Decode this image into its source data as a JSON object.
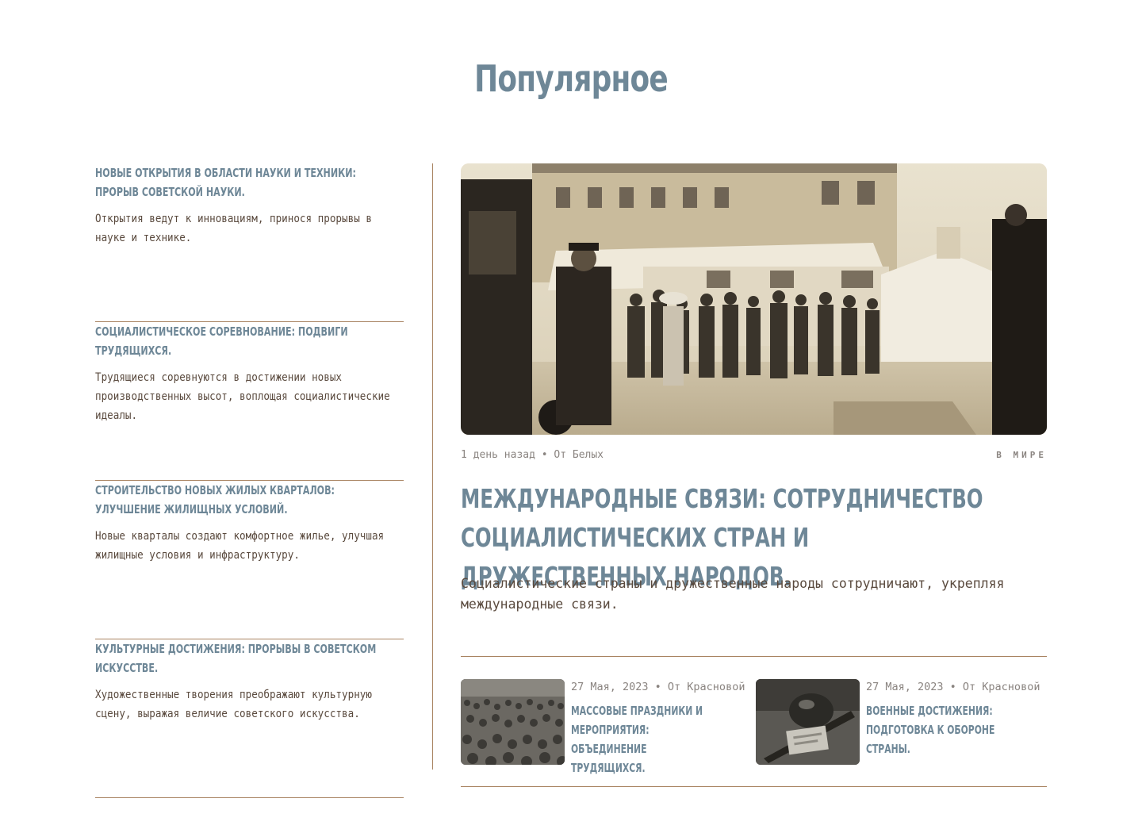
{
  "page": {
    "title": "Популярное"
  },
  "sidebar": {
    "items": [
      {
        "title": "Новые открытия в области науки и техники: прорыв советской науки.",
        "description": "Открытия ведут к инновациям, принося прорывы в науке и технике."
      },
      {
        "title": "Социалистическое соревнование: подвиги трудящихся.",
        "description": "Трудящиеся соревнуются в достижении новых производственных высот, воплощая социалистические идеалы."
      },
      {
        "title": "Строительство новых жилых кварталов: улучшение жилищных условий.",
        "description": "Новые кварталы создают комфортное жилье, улучшая жилищные условия и инфраструктуру."
      },
      {
        "title": "Культурные достижения: прорывы в советском искусстве.",
        "description": "Художественные творения преображают культурную сцену, выражая величие советского искусства."
      }
    ]
  },
  "featured": {
    "meta": "1 день назад • От Белых",
    "category": "В МИРЕ",
    "title": "Международные связи: сотрудничество социалистических стран и дружественных народов.",
    "description": "Социалистические страны и дружественные народы сотрудничают, укрепляя международные связи.",
    "image": "sepia-crowd-street-photo"
  },
  "cards": [
    {
      "meta": "27 Мая, 2023 • От Красновой",
      "title": "Массовые праздники и мероприятия: объединение трудящихся.",
      "image": "crowd-photo"
    },
    {
      "meta": "27 Мая, 2023 • От Красновой",
      "title": "Военные достижения: подготовка к обороне страны.",
      "image": "helmet-rifle-photo"
    }
  ],
  "colors": {
    "accent": "#6e8797",
    "divider": "#a98462",
    "text": "#5a4a3e",
    "muted": "#8a8480"
  }
}
